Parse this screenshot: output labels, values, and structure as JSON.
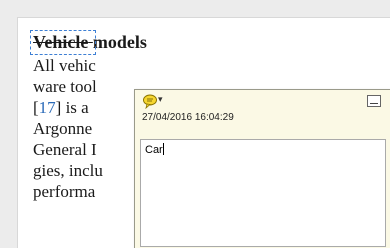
{
  "document": {
    "heading_struck": "Vehicle",
    "heading_rest": " models",
    "lines": [
      "All vehic",
      "ware tool",
      "[",
      "17",
      "]  is  a",
      "Argonne",
      "General I",
      "gies, inclu",
      "performa"
    ]
  },
  "note": {
    "date": "27/04/2016 16:04:29",
    "text": "Car",
    "caret": "▾"
  },
  "colors": {
    "link": "#2a6ab8",
    "note_background": "#fbf9e5",
    "selection_border": "#3d7fd4"
  },
  "icons": [
    "comment-icon",
    "minimize-icon",
    "resize-grip-icon"
  ]
}
